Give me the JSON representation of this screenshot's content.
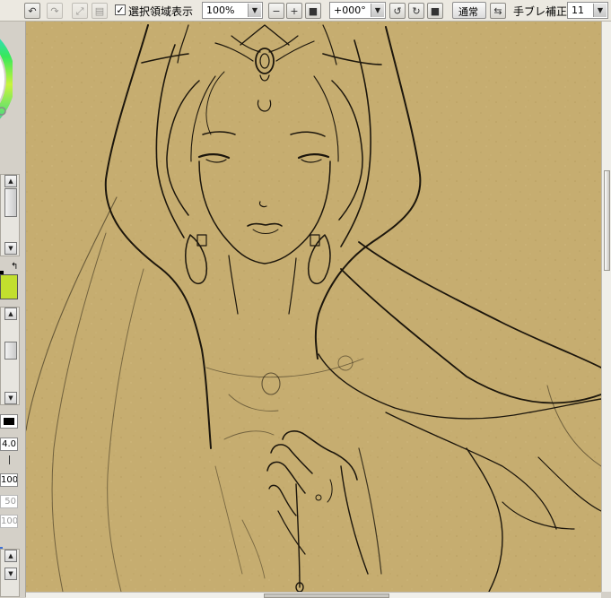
{
  "toolbar": {
    "undo_icon": "undo-icon",
    "redo_icon": "redo-icon",
    "deselect_icon": "deselect-icon",
    "selection_visible_checked": true,
    "selection_visible_label": "選択領域表示",
    "zoom_value": "100%",
    "zoom_out_symbol": "−",
    "zoom_in_symbol": "+",
    "rotation_value": "+000°",
    "blend_mode": "通常",
    "stabilizer_label": "手ブレ補正",
    "stabilizer_value": "11"
  },
  "left_panel": {
    "brush_size": "4.0",
    "density": "100",
    "value_a": "50",
    "value_b": "100",
    "value_c": "100",
    "primary_color": "#c2df2e",
    "secondary_color": "#000000"
  },
  "canvas": {
    "background_color": "#c4ab6e",
    "line_color": "#1c160c"
  }
}
